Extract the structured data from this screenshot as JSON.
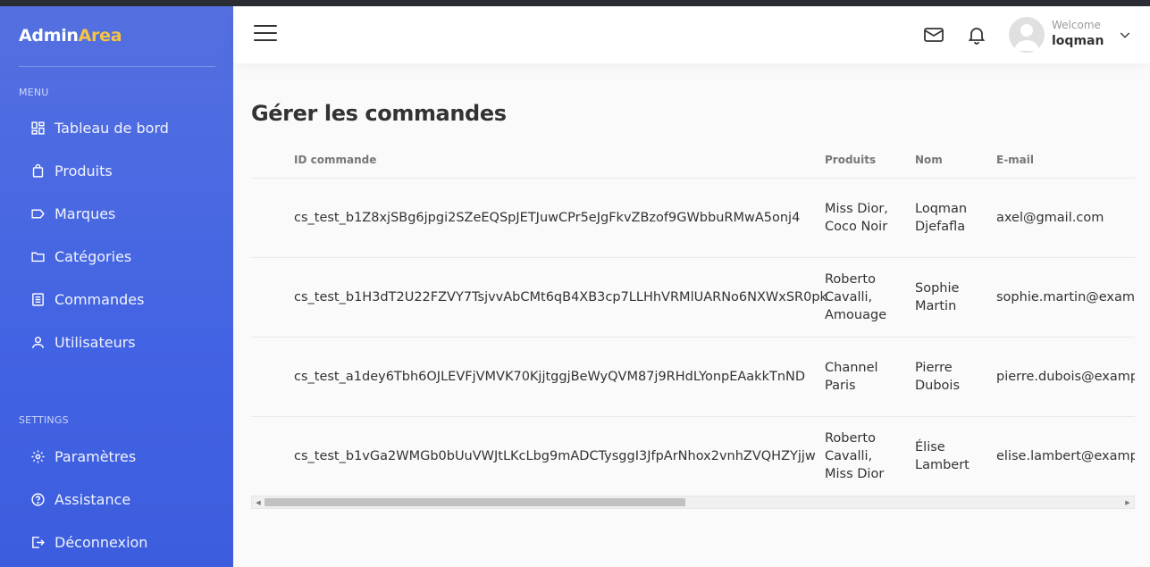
{
  "brand": {
    "name_part1": "Admin",
    "name_part2": "Area",
    "accent_color": "#f6c342"
  },
  "sidebar": {
    "menu_label": "MENU",
    "menu_items": [
      {
        "label": "Tableau de bord",
        "icon": "dashboard-icon"
      },
      {
        "label": "Produits",
        "icon": "shopping-bag-icon"
      },
      {
        "label": "Marques",
        "icon": "tag-icon"
      },
      {
        "label": "Catégories",
        "icon": "folder-icon"
      },
      {
        "label": "Commandes",
        "icon": "list-icon"
      },
      {
        "label": "Utilisateurs",
        "icon": "user-icon"
      }
    ],
    "settings_label": "SETTINGS",
    "settings_items": [
      {
        "label": "Paramètres",
        "icon": "gear-icon"
      },
      {
        "label": "Assistance",
        "icon": "help-icon"
      },
      {
        "label": "Déconnexion",
        "icon": "logout-icon"
      }
    ]
  },
  "header": {
    "icons": [
      "menu-icon",
      "mail-icon",
      "bell-icon"
    ],
    "welcome": "Welcome",
    "username": "loqman"
  },
  "page": {
    "title": "Gérer les commandes"
  },
  "orders_table": {
    "columns": [
      "ID commande",
      "Produits",
      "Nom",
      "E-mail"
    ],
    "rows": [
      {
        "id": "cs_test_b1Z8xjSBg6jpgi2SZeEQSpJETJuwCPr5eJgFkvZBzof9GWbbuRMwA5onj4",
        "products": [
          "Miss Dior,",
          "Coco Noir"
        ],
        "name": [
          "Loqman",
          "Djefafla"
        ],
        "email": "axel@gmail.com"
      },
      {
        "id": "cs_test_b1H3dT2U22FZVY7TsjvvAbCMt6qB4XB3cp7LLHhVRMlUARNo6NXWxSR0pk",
        "products": [
          "Roberto",
          "Cavalli,",
          "Amouage"
        ],
        "name": [
          "Sophie",
          "Martin"
        ],
        "email": "sophie.martin@examp"
      },
      {
        "id": "cs_test_a1dey6Tbh6OJLEVFjVMVK70KjjtggjBeWyQVM87j9RHdLYonpEAakkTnND",
        "products": [
          "Channel",
          "Paris"
        ],
        "name": [
          "Pierre",
          "Dubois"
        ],
        "email": "pierre.dubois@examp"
      },
      {
        "id": "cs_test_b1vGa2WMGb0bUuVWJtLKcLbg9mADCTysggI3JfpArNhox2vnhZVQHZYjjw",
        "products": [
          "Roberto",
          "Cavalli,",
          "Miss Dior"
        ],
        "name": [
          "Élise",
          "Lambert"
        ],
        "email": "elise.lambert@exampl"
      }
    ]
  },
  "colors": {
    "sidebar_top": "#5470e0",
    "sidebar_bottom": "#3c5ddd",
    "text": "#333333"
  }
}
